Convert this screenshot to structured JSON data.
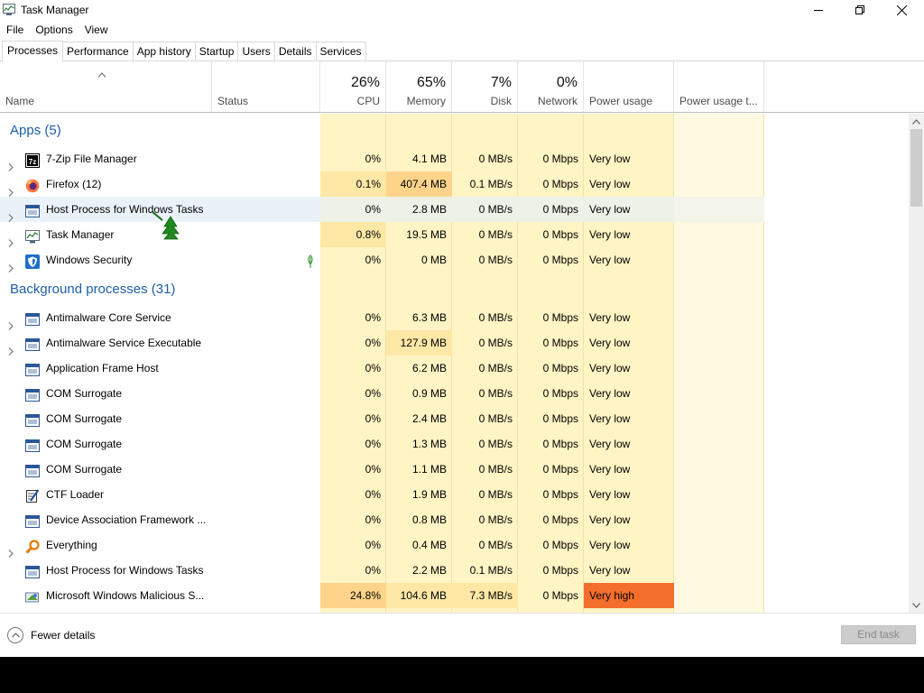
{
  "window": {
    "title": "Task Manager",
    "minimize_glyph": "—",
    "maximize_glyph": "❐",
    "close_glyph": "✕"
  },
  "menu": [
    "File",
    "Options",
    "View"
  ],
  "tabs": [
    "Processes",
    "Performance",
    "App history",
    "Startup",
    "Users",
    "Details",
    "Services"
  ],
  "active_tab": "Processes",
  "columns": {
    "name": "Name",
    "status": "Status",
    "cpu": {
      "pct": "26%",
      "label": "CPU"
    },
    "memory": {
      "pct": "65%",
      "label": "Memory"
    },
    "disk": {
      "pct": "7%",
      "label": "Disk"
    },
    "network": {
      "pct": "0%",
      "label": "Network"
    },
    "power": "Power usage",
    "power_trend": "Power usage t..."
  },
  "groups": [
    {
      "title": "Apps (5)",
      "rows": [
        {
          "name": "7-Zip File Manager",
          "icon": "7zip-icon",
          "expand": true,
          "status": "",
          "cpu": "0%",
          "memory": "4.1 MB",
          "disk": "0 MB/s",
          "network": "0 Mbps",
          "power": "Very low"
        },
        {
          "name": "Firefox (12)",
          "icon": "firefox-icon",
          "expand": true,
          "status": "",
          "cpu": "0.1%",
          "memory": "407.4 MB",
          "disk": "0.1 MB/s",
          "network": "0 Mbps",
          "power": "Very low"
        },
        {
          "name": "Host Process for Windows Tasks",
          "icon": "window-icon",
          "expand": true,
          "status": "",
          "cpu": "0%",
          "memory": "2.8 MB",
          "disk": "0 MB/s",
          "network": "0 Mbps",
          "power": "Very low"
        },
        {
          "name": "Task Manager",
          "icon": "taskmgr-icon",
          "expand": true,
          "status": "",
          "cpu": "0.8%",
          "memory": "19.5 MB",
          "disk": "0 MB/s",
          "network": "0 Mbps",
          "power": "Very low"
        },
        {
          "name": "Windows Security",
          "icon": "shield-icon",
          "expand": true,
          "status": "leaf",
          "cpu": "0%",
          "memory": "0 MB",
          "disk": "0 MB/s",
          "network": "0 Mbps",
          "power": "Very low"
        }
      ]
    },
    {
      "title": "Background processes (31)",
      "rows": [
        {
          "name": "Antimalware Core Service",
          "icon": "window-icon",
          "expand": true,
          "status": "",
          "cpu": "0%",
          "memory": "6.3 MB",
          "disk": "0 MB/s",
          "network": "0 Mbps",
          "power": "Very low"
        },
        {
          "name": "Antimalware Service Executable",
          "icon": "window-icon",
          "expand": true,
          "status": "",
          "cpu": "0%",
          "memory": "127.9 MB",
          "disk": "0 MB/s",
          "network": "0 Mbps",
          "power": "Very low"
        },
        {
          "name": "Application Frame Host",
          "icon": "window-icon",
          "expand": false,
          "status": "",
          "cpu": "0%",
          "memory": "6.2 MB",
          "disk": "0 MB/s",
          "network": "0 Mbps",
          "power": "Very low"
        },
        {
          "name": "COM Surrogate",
          "icon": "window-icon",
          "expand": false,
          "status": "",
          "cpu": "0%",
          "memory": "0.9 MB",
          "disk": "0 MB/s",
          "network": "0 Mbps",
          "power": "Very low"
        },
        {
          "name": "COM Surrogate",
          "icon": "window-icon",
          "expand": false,
          "status": "",
          "cpu": "0%",
          "memory": "2.4 MB",
          "disk": "0 MB/s",
          "network": "0 Mbps",
          "power": "Very low"
        },
        {
          "name": "COM Surrogate",
          "icon": "window-icon",
          "expand": false,
          "status": "",
          "cpu": "0%",
          "memory": "1.3 MB",
          "disk": "0 MB/s",
          "network": "0 Mbps",
          "power": "Very low"
        },
        {
          "name": "COM Surrogate",
          "icon": "window-icon",
          "expand": false,
          "status": "",
          "cpu": "0%",
          "memory": "1.1 MB",
          "disk": "0 MB/s",
          "network": "0 Mbps",
          "power": "Very low"
        },
        {
          "name": "CTF Loader",
          "icon": "ctf-icon",
          "expand": false,
          "status": "",
          "cpu": "0%",
          "memory": "1.9 MB",
          "disk": "0 MB/s",
          "network": "0 Mbps",
          "power": "Very low"
        },
        {
          "name": "Device Association Framework ...",
          "icon": "window-icon",
          "expand": false,
          "status": "",
          "cpu": "0%",
          "memory": "0.8 MB",
          "disk": "0 MB/s",
          "network": "0 Mbps",
          "power": "Very low"
        },
        {
          "name": "Everything",
          "icon": "magnifier-icon",
          "expand": true,
          "status": "",
          "cpu": "0%",
          "memory": "0.4 MB",
          "disk": "0 MB/s",
          "network": "0 Mbps",
          "power": "Very low"
        },
        {
          "name": "Host Process for Windows Tasks",
          "icon": "window-icon",
          "expand": false,
          "status": "",
          "cpu": "0%",
          "memory": "2.2 MB",
          "disk": "0.1 MB/s",
          "network": "0 Mbps",
          "power": "Very low"
        },
        {
          "name": "Microsoft Windows Malicious S...",
          "icon": "mrt-icon",
          "expand": false,
          "status": "",
          "cpu": "24.8%",
          "memory": "104.6 MB",
          "disk": "7.3 MB/s",
          "network": "0 Mbps",
          "power": "Very high"
        }
      ]
    }
  ],
  "footer": {
    "fewer_details": "Fewer details",
    "end_task": "End task"
  },
  "colors": {
    "heat_light": "#fff4c4",
    "heat_lighter": "#fff9e1",
    "heat_medium": "#ffe8a6",
    "heat_strong": "#ffd48a",
    "power_very_high": "#f46f2c",
    "group_title": "#1e5fa8"
  }
}
